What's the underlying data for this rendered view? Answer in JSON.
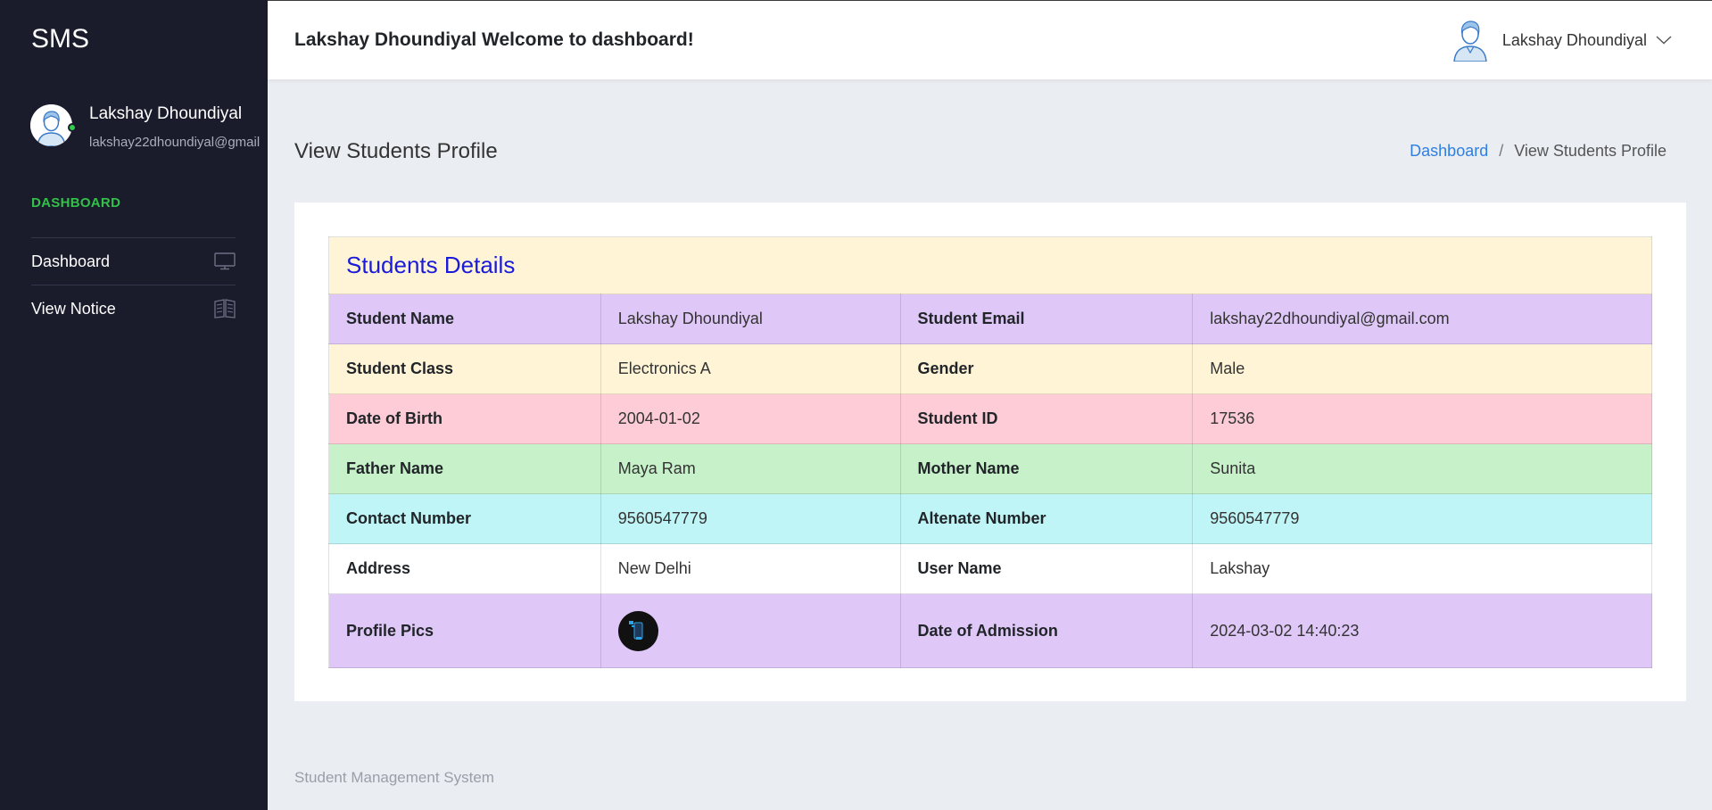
{
  "sidebar": {
    "brand": "SMS",
    "user": {
      "name": "Lakshay Dhoundiyal",
      "email": "lakshay22dhoundiyal@gmail"
    },
    "section_title": "DASHBOARD",
    "items": [
      {
        "label": "Dashboard",
        "icon": "monitor-icon"
      },
      {
        "label": "View Notice",
        "icon": "book-icon"
      }
    ]
  },
  "topbar": {
    "welcome": "Lakshay Dhoundiyal Welcome to dashboard!",
    "user_name": "Lakshay Dhoundiyal"
  },
  "page": {
    "title": "View Students Profile",
    "breadcrumb": {
      "link": "Dashboard",
      "separator": "/",
      "current": "View Students Profile"
    }
  },
  "details": {
    "caption": "Students Details",
    "rows": [
      {
        "l1": "Student Name",
        "v1": "Lakshay Dhoundiyal",
        "l2": "Student Email",
        "v2": "lakshay22dhoundiyal@gmail.com",
        "color": "#dfc8f7"
      },
      {
        "l1": "Student Class",
        "v1": "Electronics A",
        "l2": "Gender",
        "v2": "Male",
        "color": "#fff5d6"
      },
      {
        "l1": "Date of Birth",
        "v1": "2004-01-02",
        "l2": "Student ID",
        "v2": "17536",
        "color": "#fdccd6"
      },
      {
        "l1": "Father Name",
        "v1": "Maya Ram",
        "l2": "Mother Name",
        "v2": "Sunita",
        "color": "#c6f1c9"
      },
      {
        "l1": "Contact Number",
        "v1": "9560547779",
        "l2": "Altenate Number",
        "v2": "9560547779",
        "color": "#bff5f6"
      },
      {
        "l1": "Address",
        "v1": "New Delhi",
        "l2": "User Name",
        "v2": "Lakshay",
        "color": "#ffffff"
      },
      {
        "l1": "Profile Pics",
        "v1": "",
        "l2": "Date of Admission",
        "v2": "2024-03-02 14:40:23",
        "color": "#dfc8f7"
      }
    ]
  },
  "footer": {
    "text": "Student Management System"
  },
  "colors": {
    "sidebar_bg": "#1a1b2b",
    "accent_green": "#33c14a",
    "link_blue": "#2f7fe0",
    "caption_blue": "#1a1adb"
  }
}
